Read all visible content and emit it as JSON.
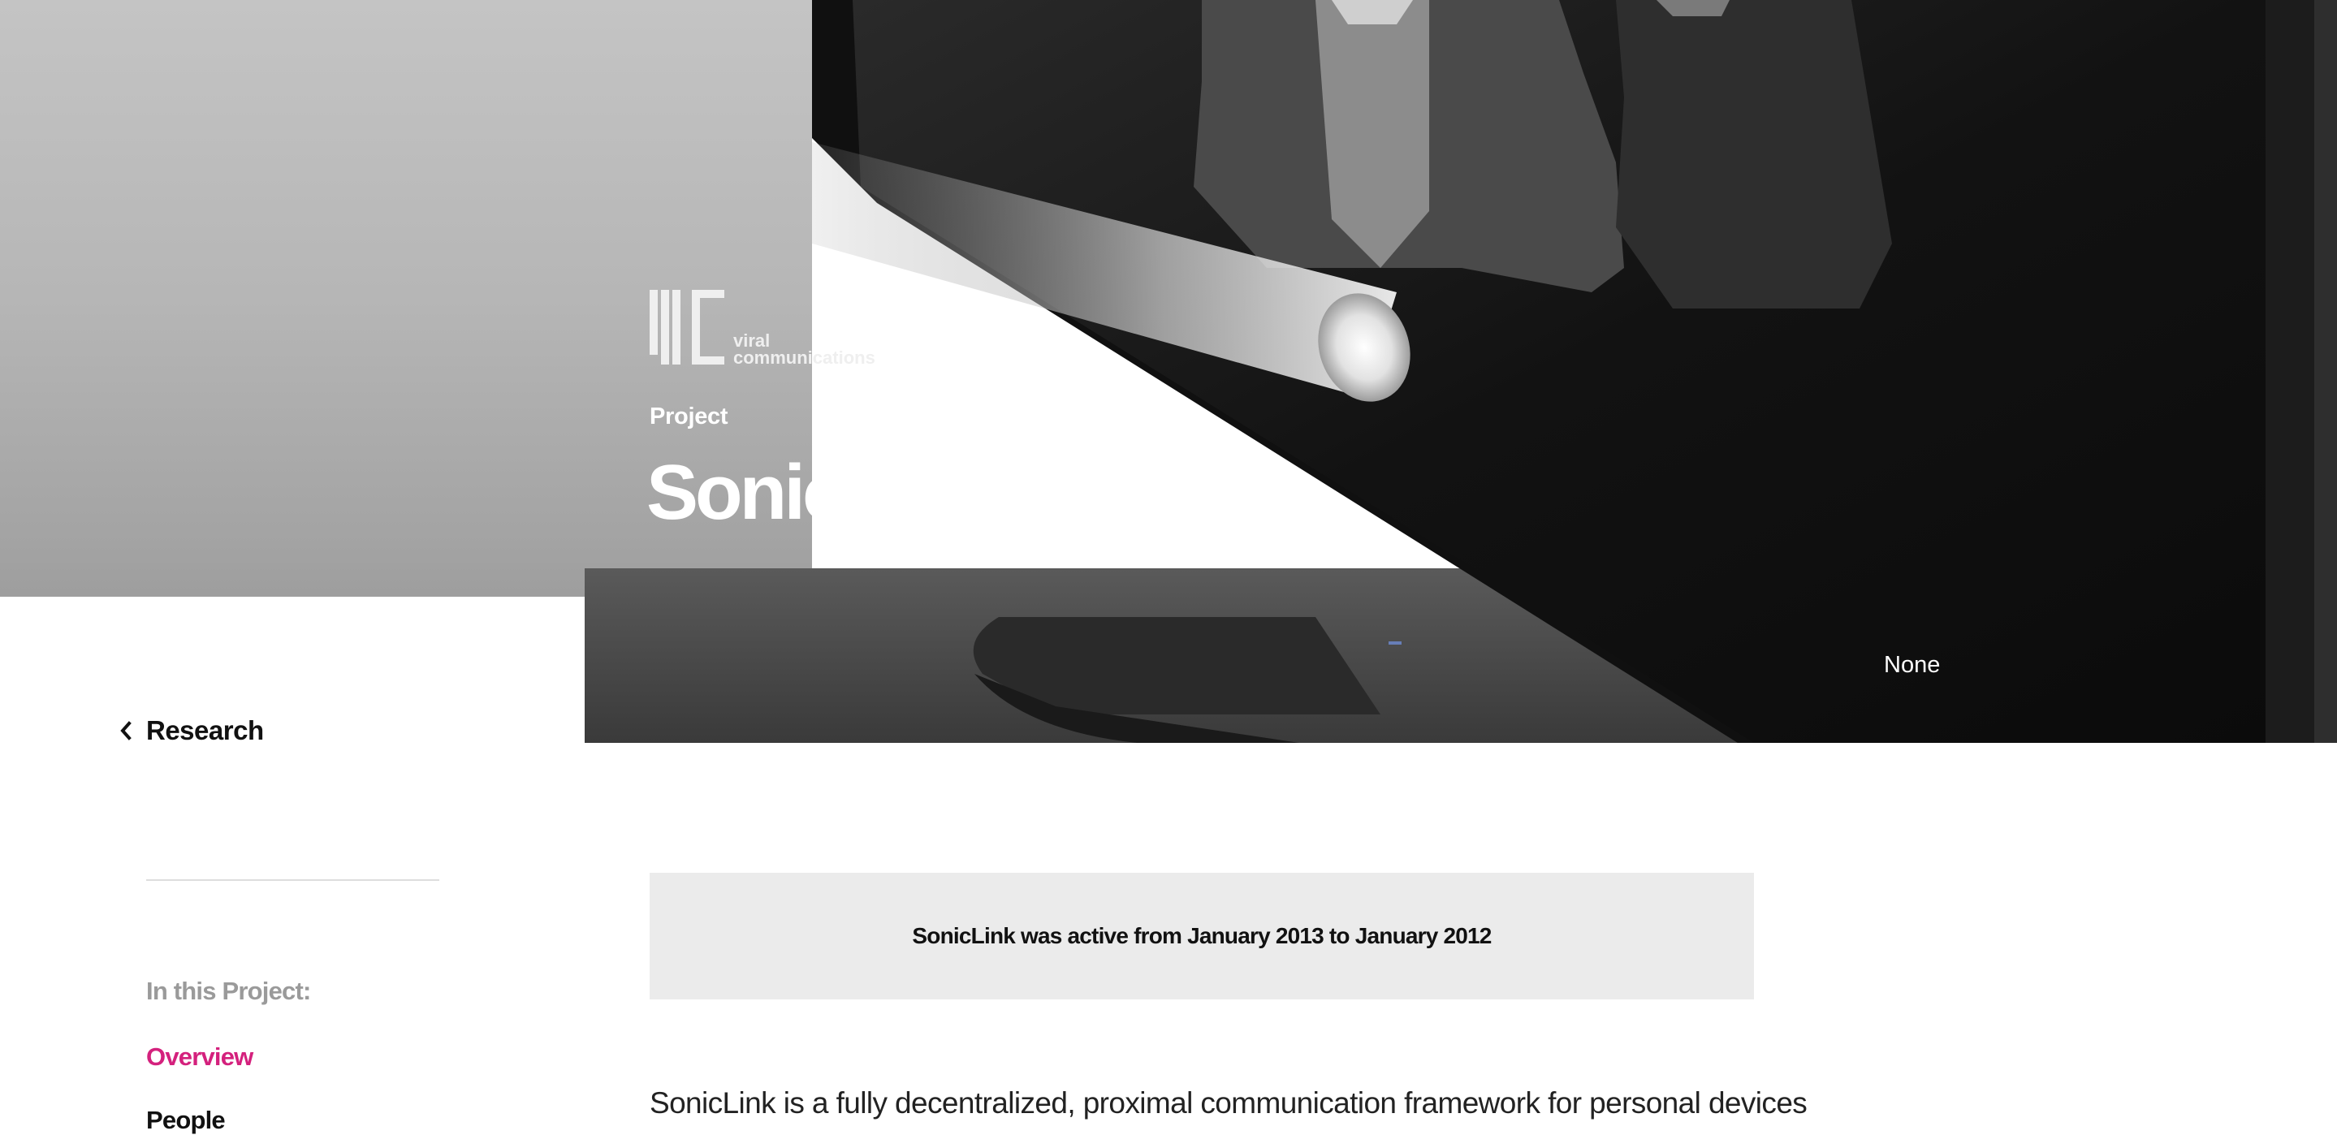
{
  "hero": {
    "logo_text_line1": "viral",
    "logo_text_line2": "communications",
    "eyebrow": "Project",
    "title": "SonicLink",
    "caption": "None"
  },
  "sidebar": {
    "back_label": "Research",
    "toc_heading": "In this Project:",
    "toc_items": [
      {
        "label": "Overview",
        "active": true
      },
      {
        "label": "People",
        "active": false
      }
    ]
  },
  "main": {
    "notice": "SonicLink was active from January 2013 to January 2012",
    "intro": "SonicLink is a fully decentralized, proximal communication framework for personal devices"
  },
  "colors": {
    "accent": "#d4217d",
    "notice_bg": "#ebebeb",
    "text": "#111111",
    "muted": "#9a9a9a"
  },
  "icons": {
    "back": "chevron-left-icon",
    "logo": "vc-logo-mark"
  }
}
